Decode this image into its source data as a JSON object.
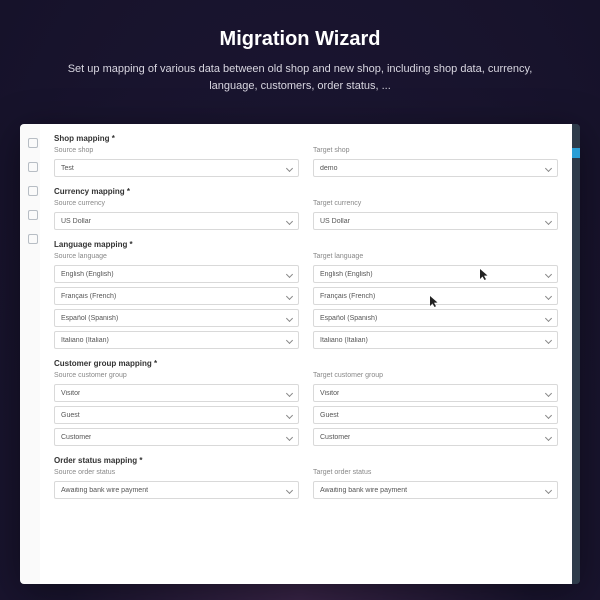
{
  "hero": {
    "title": "Migration Wizard",
    "subtitle": "Set up mapping of various data between old shop and new shop, including shop data, currency, language, customers, order status, ..."
  },
  "sections": [
    {
      "title": "Shop mapping *",
      "rows": [
        {
          "source_label": "Source shop",
          "source_value": "Test",
          "target_label": "Target shop",
          "target_value": "demo"
        }
      ]
    },
    {
      "title": "Currency mapping *",
      "rows": [
        {
          "source_label": "Source currency",
          "source_value": "US Dollar",
          "target_label": "Target currency",
          "target_value": "US Dollar"
        }
      ]
    },
    {
      "title": "Language mapping *",
      "rows": [
        {
          "source_label": "Source language",
          "source_value": "English (English)",
          "target_label": "Target language",
          "target_value": "English (English)"
        },
        {
          "source_label": "",
          "source_value": "Français (French)",
          "target_label": "",
          "target_value": "Français (French)"
        },
        {
          "source_label": "",
          "source_value": "Español (Spanish)",
          "target_label": "",
          "target_value": "Español (Spanish)"
        },
        {
          "source_label": "",
          "source_value": "Italiano (Italian)",
          "target_label": "",
          "target_value": "Italiano (Italian)"
        }
      ]
    },
    {
      "title": "Customer group mapping *",
      "rows": [
        {
          "source_label": "Source customer group",
          "source_value": "Visitor",
          "target_label": "Target customer group",
          "target_value": "Visitor"
        },
        {
          "source_label": "",
          "source_value": "Guest",
          "target_label": "",
          "target_value": "Guest"
        },
        {
          "source_label": "",
          "source_value": "Customer",
          "target_label": "",
          "target_value": "Customer"
        }
      ]
    },
    {
      "title": "Order status mapping *",
      "rows": [
        {
          "source_label": "Source order status",
          "source_value": "Awaiting bank wire payment",
          "target_label": "Target order status",
          "target_value": "Awaiting bank wire payment"
        }
      ]
    }
  ]
}
